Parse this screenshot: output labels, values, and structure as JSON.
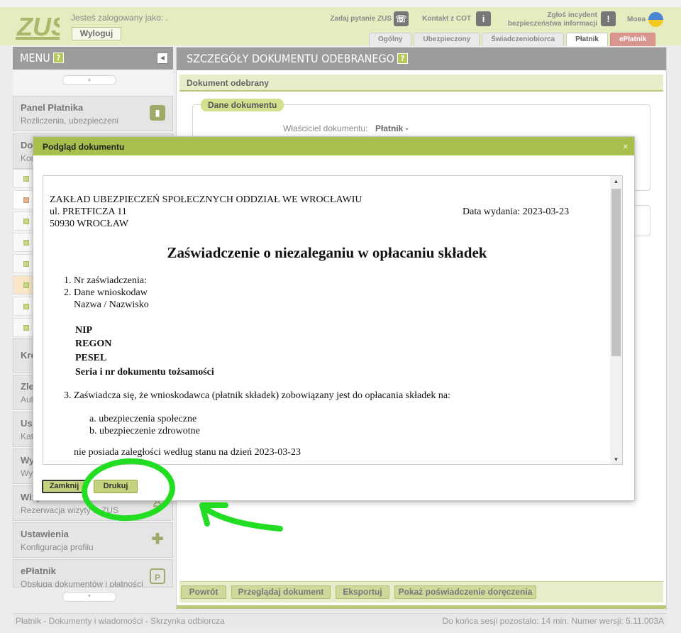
{
  "header": {
    "logo_text": "ZUS",
    "logged_as": "Jesteś zalogowany jako: .",
    "logout": "Wyloguj",
    "ask_zus": "Zadaj pytanie ZUS",
    "contact_cot": "Kontakt z COT",
    "report_incident_line1": "Zgłoś incydent",
    "report_incident_line2": "bezpieczeństwa informacji",
    "language": "Мова",
    "tabs": [
      {
        "label": "Ogólny"
      },
      {
        "label": "Ubezpieczony"
      },
      {
        "label": "Świadczeniobiorca"
      },
      {
        "label": "Płatnik"
      },
      {
        "label": "ePłatnik"
      }
    ],
    "active_tab": "Płatnik"
  },
  "sidebar": {
    "title": "MENU",
    "help": "?",
    "items": [
      {
        "title": "Panel Płatnika",
        "subtitle": "Rozliczenia, ubezpieczeni"
      },
      {
        "title": "Dok",
        "subtitle": "Kon"
      },
      {
        "title": "Kre",
        "subtitle": ""
      },
      {
        "title": "Zle",
        "subtitle": "Aut"
      },
      {
        "title": "Usł",
        "subtitle": "Kat"
      },
      {
        "title": "Wy",
        "subtitle": "Wys"
      },
      {
        "title": "Wizy",
        "subtitle": "Rezerwacja wizyty w ZUS"
      },
      {
        "title": "Ustawienia",
        "subtitle": "Konfiguracja profilu"
      },
      {
        "title": "ePłatnik",
        "subtitle": "Obsługa dokumentów i płatności"
      }
    ]
  },
  "main": {
    "title": "SZCZEGÓŁY DOKUMENTU ODEBRANEGO",
    "help": "?",
    "section_title": "Dokument odebrany",
    "fieldset_title": "Dane dokumentu",
    "owner_label": "Właściciel dokumentu:",
    "owner_value": "Płatnik -",
    "buttons": {
      "back": "Powrót",
      "view": "Przeglądaj dokument",
      "export": "Eksportuj",
      "show_receipt": "Pokaż poświadczenie doręczenia"
    }
  },
  "modal": {
    "title": "Podgląd dokumentu",
    "close_x": "×",
    "close_button": "Zamknij",
    "print_button": "Drukuj",
    "document": {
      "issuer_line1": "ZAKŁAD UBEZPIECZEŃ SPOŁECZNYCH ODDZIAŁ WE WROCŁAWIU",
      "issuer_line2": "ul. PRETFICZA  11",
      "issuer_line3": "50930  WROCŁAW",
      "issue_date": "Data wydania: 2023-03-23",
      "heading": "Zaświadczenie o niezaleganiu w opłacaniu składek",
      "item1": "1. Nr zaświadczenia:",
      "item2": "2. Dane wnioskodaw",
      "item2_sub": "Nazwa / Nazwisko",
      "nip": "NIP",
      "regon": "REGON",
      "pesel": "PESEL",
      "id_doc": "Seria i nr dokumentu tożsamości",
      "item3": "3. Zaświadcza się, że wnioskodawca (płatnik składek) zobowiązany jest do opłacania składek na:",
      "item3a": "a. ubezpieczenia społeczne",
      "item3b": "b. ubezpieczenie zdrowotne",
      "no_arrears": "nie posiada zaległości według stanu na dzień 2023-03-23"
    }
  },
  "statusbar": {
    "breadcrumb": "Płatnik - Dokumenty i wiadomości - Skrzynka odbiorcza",
    "session": "Do końca sesji pozostało: 14 min.   Numer wersji: 5.11.003A"
  },
  "colors": {
    "accent_green": "#a6c04b",
    "annotation_green": "#22dd22",
    "header_bg": "#e5ecbf"
  }
}
